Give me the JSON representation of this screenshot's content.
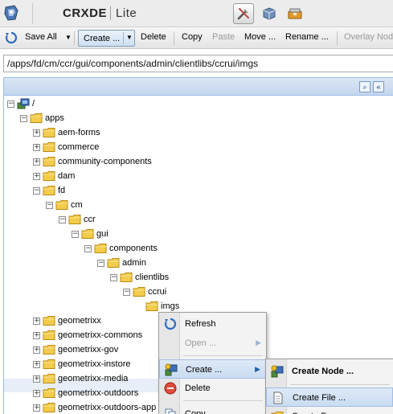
{
  "header": {
    "brand": "CRXDE",
    "brand_suffix": "Lite",
    "modes": [
      {
        "name": "develop",
        "icon": "tools-icon",
        "active": true
      },
      {
        "name": "access-control",
        "icon": "cube-icon",
        "active": false
      },
      {
        "name": "replication",
        "icon": "package-icon",
        "active": false
      }
    ]
  },
  "toolbar": {
    "save_all": "Save All",
    "create": "Create ...",
    "delete": "Delete",
    "copy": "Copy",
    "paste": "Paste",
    "move": "Move ...",
    "rename": "Rename ...",
    "overlay": "Overlay Nod"
  },
  "path": "/apps/fd/cm/ccr/gui/components/admin/clientlibs/ccrui/imgs",
  "tree": {
    "nodes": [
      {
        "label": "/",
        "level": 0,
        "state": "open",
        "root": true
      },
      {
        "label": "apps",
        "level": 1,
        "state": "open"
      },
      {
        "label": "aem-forms",
        "level": 2,
        "state": "closed"
      },
      {
        "label": "commerce",
        "level": 2,
        "state": "closed"
      },
      {
        "label": "community-components",
        "level": 2,
        "state": "closed"
      },
      {
        "label": "dam",
        "level": 2,
        "state": "closed"
      },
      {
        "label": "fd",
        "level": 2,
        "state": "open"
      },
      {
        "label": "cm",
        "level": 3,
        "state": "open"
      },
      {
        "label": "ccr",
        "level": 4,
        "state": "open"
      },
      {
        "label": "gui",
        "level": 5,
        "state": "open"
      },
      {
        "label": "components",
        "level": 6,
        "state": "open"
      },
      {
        "label": "admin",
        "level": 7,
        "state": "open"
      },
      {
        "label": "clientlibs",
        "level": 8,
        "state": "open"
      },
      {
        "label": "ccrui",
        "level": 9,
        "state": "open"
      },
      {
        "label": "imgs",
        "level": 10,
        "state": "leaf",
        "selected": true
      },
      {
        "label": "geometrixx",
        "level": 2,
        "state": "closed"
      },
      {
        "label": "geometrixx-commons",
        "level": 2,
        "state": "closed"
      },
      {
        "label": "geometrixx-gov",
        "level": 2,
        "state": "closed"
      },
      {
        "label": "geometrixx-instore",
        "level": 2,
        "state": "closed"
      },
      {
        "label": "geometrixx-media",
        "level": 2,
        "state": "closed"
      },
      {
        "label": "geometrixx-outdoors",
        "level": 2,
        "state": "closed"
      },
      {
        "label": "geometrixx-outdoors-app",
        "level": 2,
        "state": "closed"
      }
    ]
  },
  "context_menu": {
    "items": [
      {
        "label": "Refresh",
        "icon": "refresh-icon",
        "disabled": false
      },
      {
        "label": "Open ...",
        "icon": "",
        "disabled": true,
        "submenu": true
      },
      {
        "label": "Create ...",
        "icon": "create-icon",
        "disabled": false,
        "submenu": true,
        "highlighted": true
      },
      {
        "label": "Delete",
        "icon": "delete-icon",
        "disabled": false
      },
      {
        "label": "Copy",
        "icon": "copy-icon",
        "disabled": false
      }
    ]
  },
  "submenu": {
    "items": [
      {
        "label": "Create Node ...",
        "icon": "node-icon"
      },
      {
        "label": "Create File ...",
        "icon": "file-icon",
        "highlighted": true
      },
      {
        "label": "Create Fo",
        "icon": "folder-icon"
      }
    ]
  }
}
